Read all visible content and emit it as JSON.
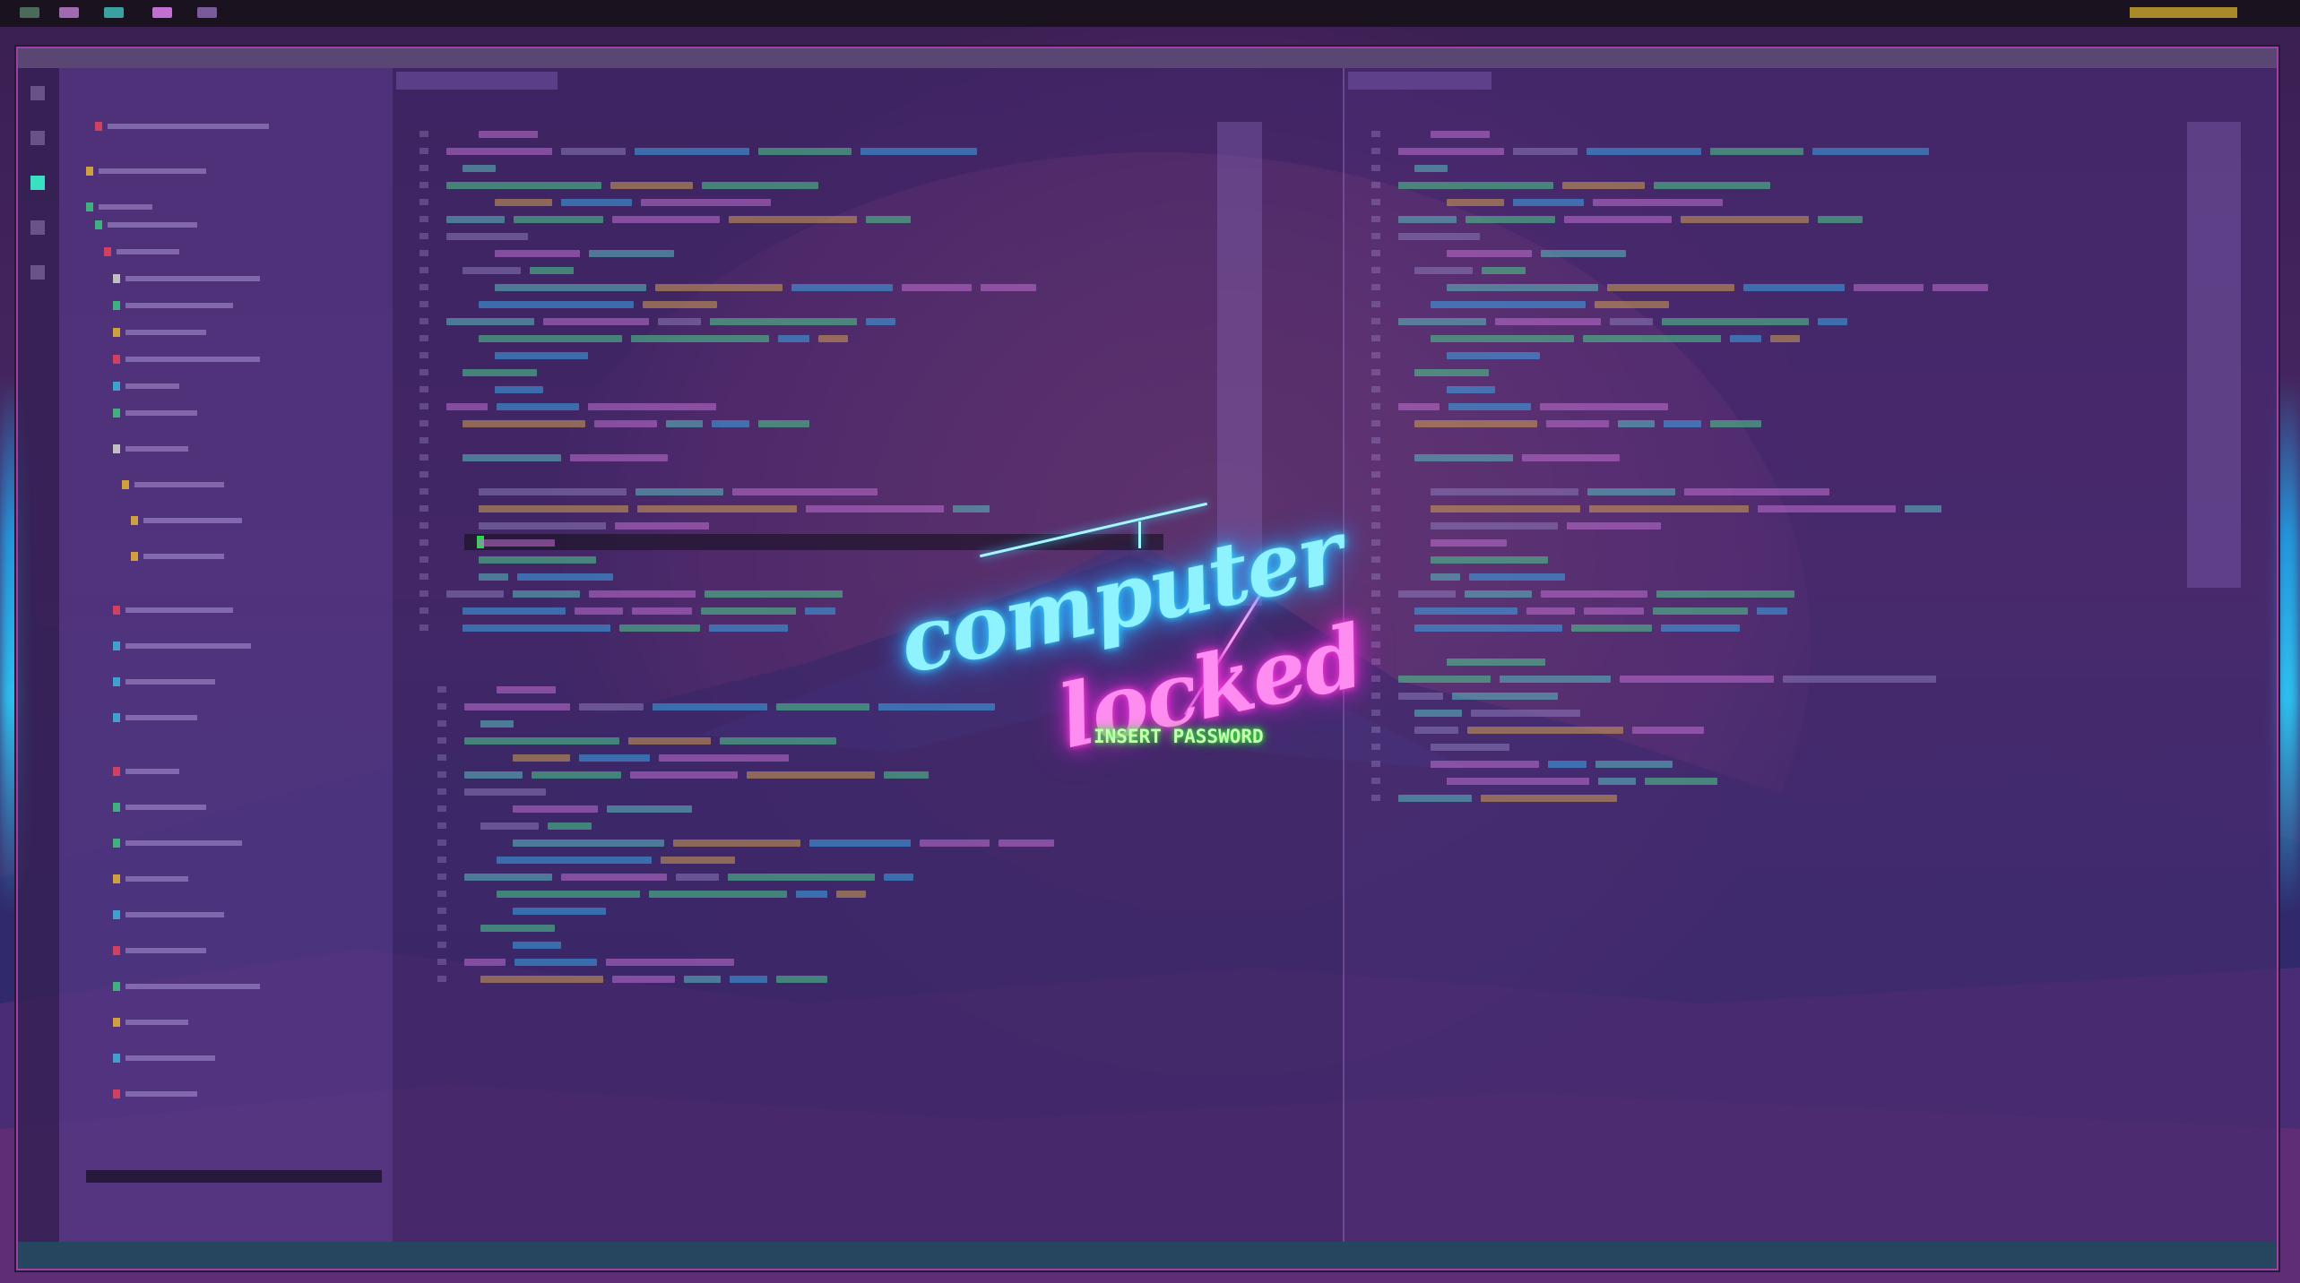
{
  "lock_screen": {
    "line1": "computer",
    "line2": "locked",
    "prompt": "INSERT PASSWORD"
  },
  "colors": {
    "neon_cyan": "#2fd6ff",
    "neon_magenta": "#ff3cdc",
    "neon_green": "#39ff3a",
    "window_border": "#a03fa8",
    "background": "#3a1f52"
  },
  "icons": [
    "workspace-indicator-icon",
    "files-icon",
    "search-icon",
    "git-icon"
  ]
}
